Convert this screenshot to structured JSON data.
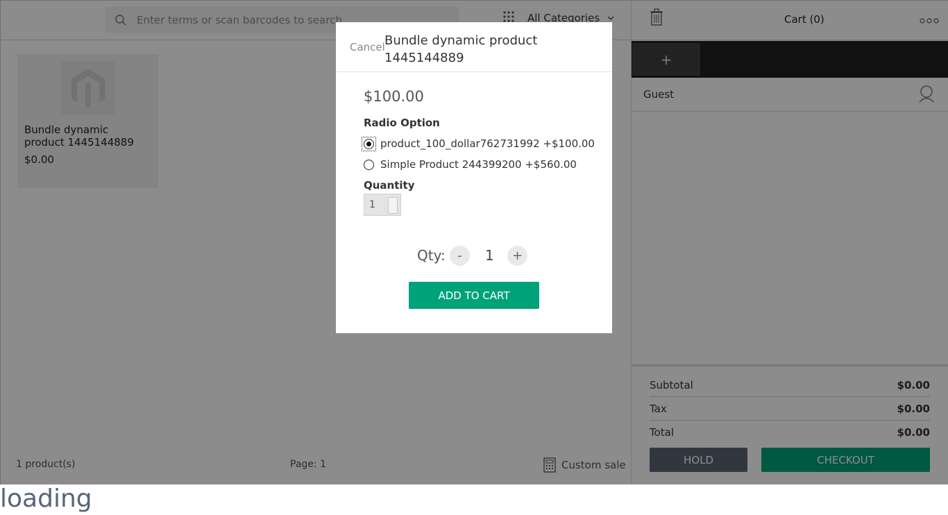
{
  "search": {
    "placeholder": "Enter terms or scan barcodes to search"
  },
  "categories": {
    "label": "All Categories"
  },
  "products": [
    {
      "name": "Bundle dynamic product 1445144889",
      "price": "$0.00"
    }
  ],
  "footer": {
    "count": "1 product(s)",
    "page": "Page: 1",
    "custom_sale": "Custom sale"
  },
  "cart": {
    "title": "Cart (0)",
    "add_tab": "+",
    "customer": "Guest",
    "totals": [
      {
        "label": "Subtotal",
        "value": "$0.00"
      },
      {
        "label": "Tax",
        "value": "$0.00"
      },
      {
        "label": "Total",
        "value": "$0.00"
      }
    ],
    "hold": "HOLD",
    "checkout": "CHECKOUT"
  },
  "modal": {
    "cancel": "Cancel",
    "title": "Bundle dynamic product 1445144889",
    "price": "$100.00",
    "option_label": "Radio Option",
    "options": [
      {
        "label": "product_100_dollar762731992  +$100.00",
        "selected": true
      },
      {
        "label": "Simple Product 244399200  +$560.00",
        "selected": false
      }
    ],
    "quantity_label": "Quantity",
    "quantity_value": "1",
    "qty_label": "Qty:",
    "qty_value": "1",
    "minus": "-",
    "plus": "+",
    "add_to_cart": "ADD TO CART"
  },
  "status": {
    "loading": "loading"
  },
  "colors": {
    "accent": "#00a27a",
    "hold": "#5a6374",
    "tabbar": "#1f1f1f"
  }
}
